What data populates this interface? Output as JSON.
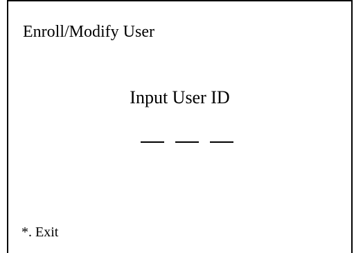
{
  "screen": {
    "title": "Enroll/Modify User",
    "prompt": "Input User ID",
    "user_id": {
      "slots": 3,
      "value": ""
    },
    "exit_label": "*. Exit"
  }
}
